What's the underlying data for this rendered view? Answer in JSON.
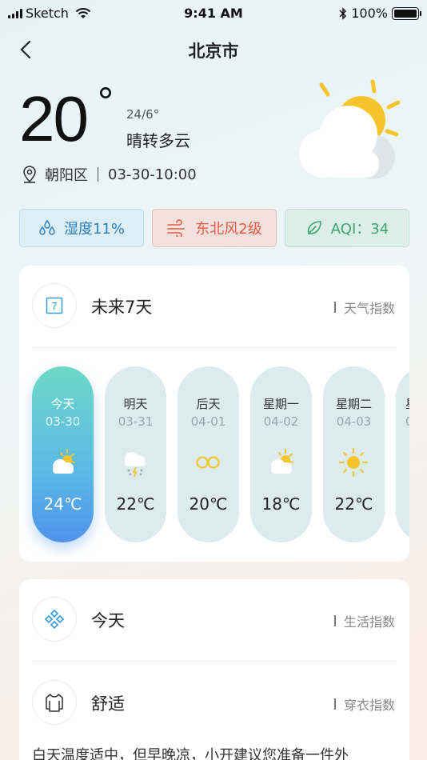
{
  "status_bar": {
    "carrier": "Sketch",
    "time": "9:41 AM",
    "battery": "100%",
    "battery_level": 1.0
  },
  "nav": {
    "title": "北京市"
  },
  "current": {
    "temperature": "20",
    "range": "24/6°",
    "condition": "晴转多云",
    "district": "朝阳区",
    "updated": "03-30-10:00"
  },
  "chips": {
    "humidity": "湿度11%",
    "wind": "东北风2级",
    "aqi": "AQI：34"
  },
  "forecast_card": {
    "title": "未来7天",
    "link": "天气指数",
    "calendar_number": "7",
    "days": [
      {
        "name": "今天",
        "date": "03-30",
        "temp": "24℃",
        "icon": "partly-cloudy-icon"
      },
      {
        "name": "明天",
        "date": "03-31",
        "temp": "22℃",
        "icon": "thunder-rain-icon"
      },
      {
        "name": "后天",
        "date": "04-01",
        "temp": "20℃",
        "icon": "infinity-sun-icon"
      },
      {
        "name": "星期一",
        "date": "04-02",
        "temp": "18℃",
        "icon": "partly-cloudy-icon"
      },
      {
        "name": "星期二",
        "date": "04-03",
        "temp": "22℃",
        "icon": "sun-icon"
      },
      {
        "name": "星",
        "date": "0",
        "temp": "",
        "icon": ""
      }
    ]
  },
  "life_card": {
    "title": "今天",
    "link": "生活指数",
    "sub_title": "舒适",
    "sub_link": "穿衣指数",
    "advice": "白天温度适中，但早晚凉，小开建议您准备一件外"
  },
  "colors": {
    "humidity": "#2d80bb",
    "wind": "#e55a45",
    "aqi": "#3aa672",
    "sun": "#f7c52b"
  }
}
